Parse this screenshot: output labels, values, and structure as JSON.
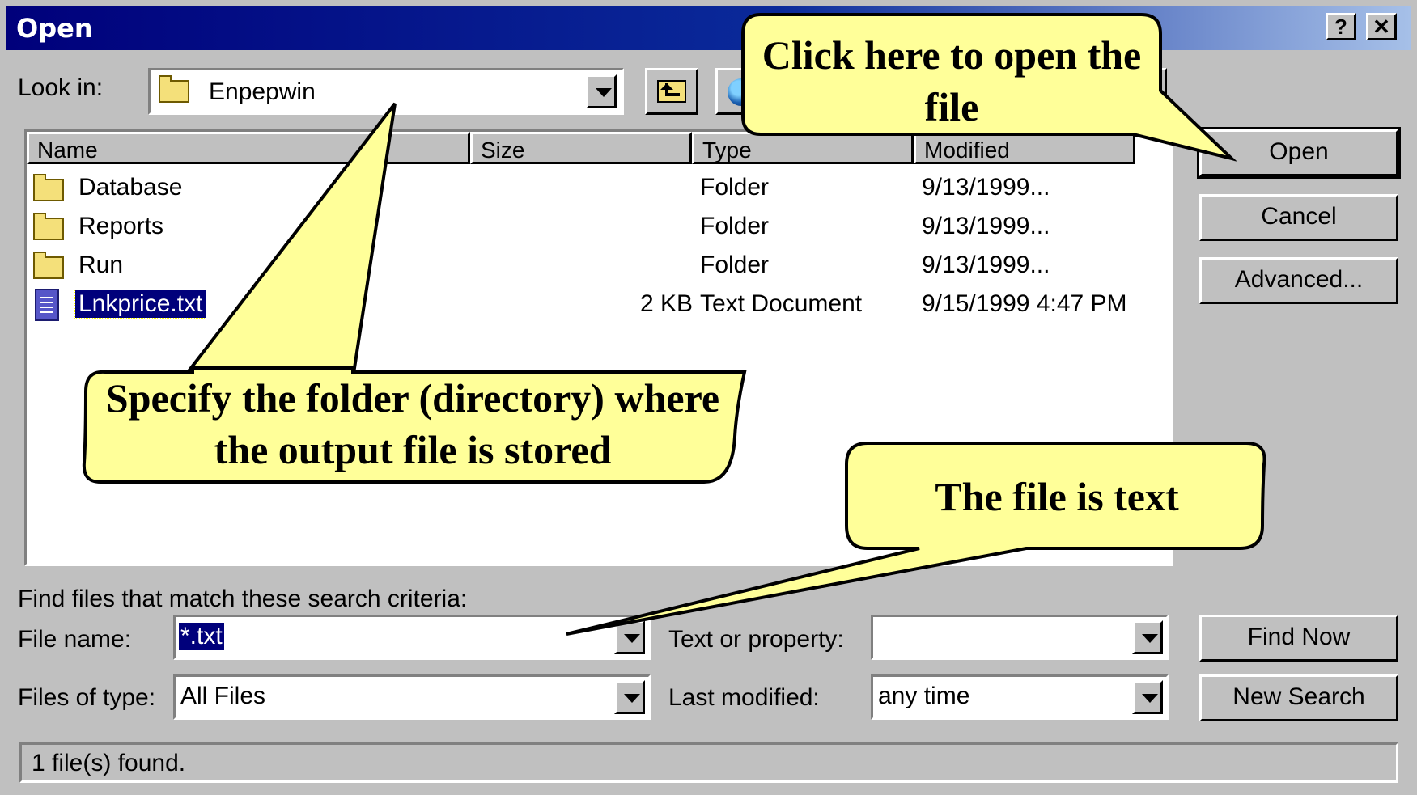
{
  "window": {
    "title": "Open",
    "help_label": "?",
    "close_label": "✕"
  },
  "look_in": {
    "label": "Look in:",
    "value": "Enpepwin",
    "folder_icon": "folder-icon",
    "up_icon": "up-one-level-icon",
    "web_icon": "web-folders-icon"
  },
  "file_list": {
    "columns": [
      "Name",
      "Size",
      "Type",
      "Modified"
    ],
    "rows": [
      {
        "name": "Database",
        "size": "",
        "type": "Folder",
        "modified": "9/13/1999...",
        "icon": "folder-icon"
      },
      {
        "name": "Reports",
        "size": "",
        "type": "Folder",
        "modified": "9/13/1999...",
        "icon": "folder-icon"
      },
      {
        "name": "Run",
        "size": "",
        "type": "Folder",
        "modified": "9/13/1999...",
        "icon": "folder-icon"
      },
      {
        "name": "Lnkprice.txt",
        "size": "2 KB",
        "type": "Text Document",
        "modified": "9/15/1999 4:47 PM",
        "icon": "text-document-icon",
        "selected": true
      }
    ]
  },
  "buttons": {
    "open": "Open",
    "cancel": "Cancel",
    "advanced": "Advanced...",
    "find_now": "Find Now",
    "new_search": "New Search"
  },
  "search": {
    "heading": "Find files that match these search criteria:",
    "file_name_label": "File name:",
    "file_name_value": "*.txt",
    "files_of_type_label": "Files of type:",
    "files_of_type_value": "All Files",
    "text_property_label": "Text or property:",
    "text_property_value": "",
    "last_modified_label": "Last modified:",
    "last_modified_value": "any time"
  },
  "status": "1 file(s) found.",
  "callouts": {
    "open_file": "Click here to open the file",
    "folder": "Specify the folder (directory) where the output file is stored",
    "text_file": "The file is text"
  },
  "colors": {
    "callout_fill": "#ffff99",
    "selection": "#00007b",
    "dialog_bg": "#c0c0c0"
  }
}
